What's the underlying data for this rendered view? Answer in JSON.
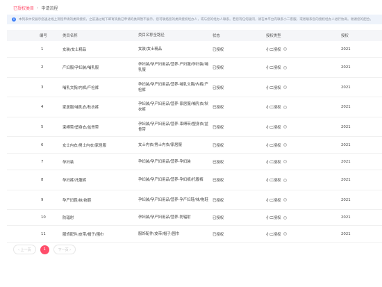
{
  "breadcrumb": {
    "current": "已授权类目",
    "separator": "›",
    "next": "申请流程"
  },
  "notice": {
    "text": "本列表中仅展示您通过线上流程申请的类目授权，之前通过线下邮寄资质已申请的类目暂不展示。您可联络您的类目授权经办人，或与您的经办人联系。若您有任何疑问，请在本平台内联系小二客服，或者联系您的授权经办人进行协商。谢谢您的配合。"
  },
  "table": {
    "headers": {
      "no": "编号",
      "name": "类目名称",
      "path": "类目名称全路径",
      "status": "状态",
      "type": "授权类型",
      "date": "授权"
    },
    "rows": [
      {
        "no": "1",
        "name": "女装/女士精品",
        "path": "女装/女士精品",
        "status": "已授权",
        "type": "小二授权",
        "date": "2021"
      },
      {
        "no": "2",
        "name": "产妇服/孕妇装/哺乳服",
        "path": "孕妇装/孕产妇用品/营养-产妇服/孕妇装/哺乳服",
        "status": "已授权",
        "type": "小二授权",
        "date": "2021"
      },
      {
        "no": "3",
        "name": "哺乳文胸/内裤/产检裤",
        "path": "孕妇装/孕产妇用品/营养-哺乳文胸/内裤/产检裤",
        "status": "已授权",
        "type": "小二授权",
        "date": "2021"
      },
      {
        "no": "4",
        "name": "家居服/哺乳衣/秋衣裤",
        "path": "孕妇装/孕产妇用品/营养-家居服/哺乳衣/秋衣裤",
        "status": "已授权",
        "type": "小二授权",
        "date": "2021"
      },
      {
        "no": "5",
        "name": "束缚带/塑身衣/盆骨带",
        "path": "孕妇装/孕产妇用品/营养-束缚带/塑身衣/盆骨带",
        "status": "已授权",
        "type": "小二授权",
        "date": "2021"
      },
      {
        "no": "6",
        "name": "女士内衣/男士内衣/家居服",
        "path": "女士内衣/男士内衣/家居服",
        "status": "已授权",
        "type": "小二授权",
        "date": "2021"
      },
      {
        "no": "7",
        "name": "孕妇装",
        "path": "孕妇装/孕产妇用品/营养-孕妇装",
        "status": "已授权",
        "type": "小二授权",
        "date": "2021"
      },
      {
        "no": "8",
        "name": "孕妇裤/托腹裤",
        "path": "孕妇装/孕产妇用品/营养-孕妇裤/托腹裤",
        "status": "已授权",
        "type": "小二授权",
        "date": "2021"
      },
      {
        "no": "9",
        "name": "孕产妇鞋/袜/拖鞋",
        "path": "孕妇装/孕产妇用品/营养-孕产妇鞋/袜/拖鞋",
        "status": "已授权",
        "type": "小二授权",
        "date": "2021"
      },
      {
        "no": "10",
        "name": "防辐射",
        "path": "孕妇装/孕产妇用品/营养-防辐射",
        "status": "已授权",
        "type": "小二授权",
        "date": "2021"
      },
      {
        "no": "11",
        "name": "服饰配件/皮带/帽子/围巾",
        "path": "服饰配件/皮带/帽子/围巾",
        "status": "已授权",
        "type": "小二授权",
        "date": "2021"
      }
    ]
  },
  "pager": {
    "prev": "‹ 上一页",
    "current": "1",
    "next": "下一页 ›"
  }
}
